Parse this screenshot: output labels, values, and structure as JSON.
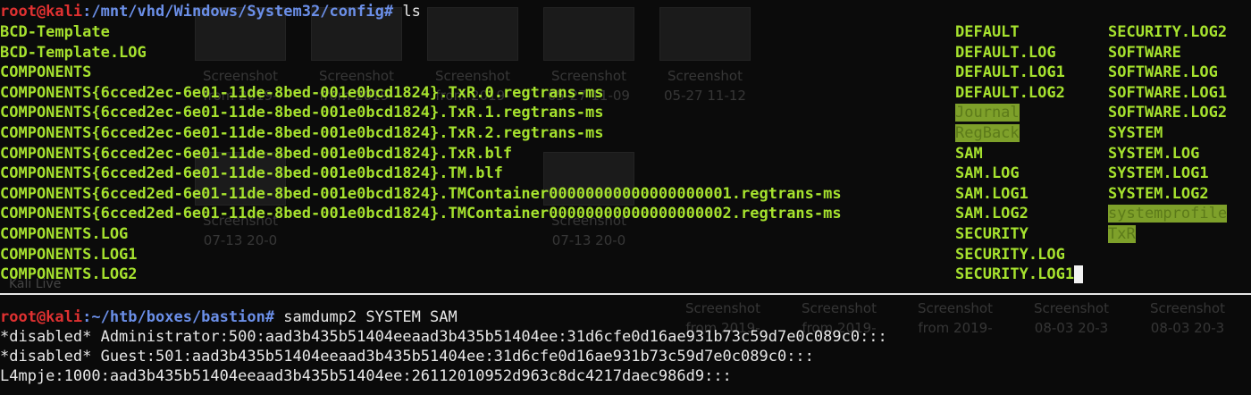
{
  "terminal_top": {
    "prompt_user": "root@kali",
    "prompt_path": ":/mnt/vhd/Windows/System32/config#",
    "command": " ls",
    "col1": [
      "BCD-Template",
      "BCD-Template.LOG",
      "COMPONENTS",
      "COMPONENTS{6cced2ec-6e01-11de-8bed-001e0bcd1824}.TxR.0.regtrans-ms",
      "COMPONENTS{6cced2ec-6e01-11de-8bed-001e0bcd1824}.TxR.1.regtrans-ms",
      "COMPONENTS{6cced2ec-6e01-11de-8bed-001e0bcd1824}.TxR.2.regtrans-ms",
      "COMPONENTS{6cced2ec-6e01-11de-8bed-001e0bcd1824}.TxR.blf",
      "COMPONENTS{6cced2ed-6e01-11de-8bed-001e0bcd1824}.TM.blf",
      "COMPONENTS{6cced2ed-6e01-11de-8bed-001e0bcd1824}.TMContainer00000000000000000001.regtrans-ms",
      "COMPONENTS{6cced2ed-6e01-11de-8bed-001e0bcd1824}.TMContainer00000000000000000002.regtrans-ms",
      "COMPONENTS.LOG",
      "COMPONENTS.LOG1",
      "COMPONENTS.LOG2"
    ],
    "col2": [
      "DEFAULT",
      "DEFAULT.LOG",
      "DEFAULT.LOG1",
      "DEFAULT.LOG2",
      "Journal",
      "RegBack",
      "SAM",
      "SAM.LOG",
      "SAM.LOG1",
      "SAM.LOG2",
      "SECURITY",
      "SECURITY.LOG",
      "SECURITY.LOG1"
    ],
    "col3": [
      "SECURITY.LOG2",
      "SOFTWARE",
      "SOFTWARE.LOG",
      "SOFTWARE.LOG1",
      "SOFTWARE.LOG2",
      "SYSTEM",
      "SYSTEM.LOG",
      "SYSTEM.LOG1",
      "SYSTEM.LOG2",
      "systemprofile",
      "TxR"
    ]
  },
  "terminal_bottom": {
    "prompt_user": "root@kali",
    "prompt_path": ":~/htb/boxes/bastion#",
    "command": " samdump2 SYSTEM SAM",
    "output": [
      "*disabled* Administrator:500:aad3b435b51404eeaad3b435b51404ee:31d6cfe0d16ae931b73c59d7e0c089c0:::",
      "*disabled* Guest:501:aad3b435b51404eeaad3b435b51404ee:31d6cfe0d16ae931b73c59d7e0c089c0:::",
      "L4mpje:1000:aad3b435b51404eeaad3b435b51404ee:26112010952d963c8dc4217daec986d9:::"
    ]
  },
  "background": {
    "thumb_label": "Screenshot",
    "thumb_lines": [
      "from 2019-",
      "05-27 11-09",
      "05-27 11-12",
      "07-13 20-0",
      "08-03 20-3"
    ],
    "taskbar_label": "Kali Live"
  },
  "colors": {
    "prompt_user": "#e03131",
    "prompt_path": "#6b8fe8",
    "file_green": "#a6e22e",
    "dir_highlight": "#7ea02a"
  }
}
